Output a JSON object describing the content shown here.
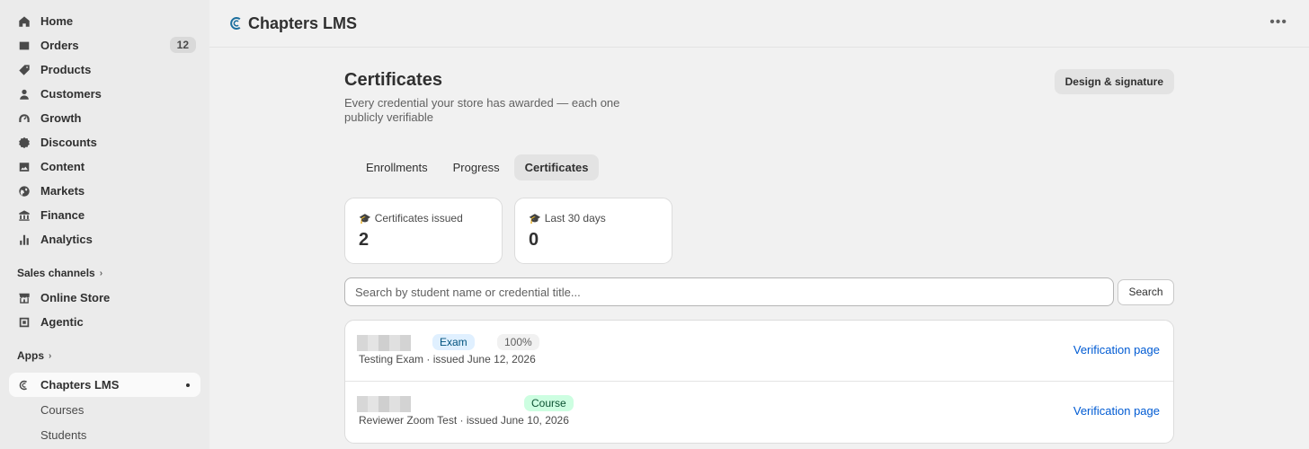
{
  "sidebar": {
    "items": [
      {
        "label": "Home",
        "icon": "home-icon"
      },
      {
        "label": "Orders",
        "icon": "orders-icon",
        "badge": "12"
      },
      {
        "label": "Products",
        "icon": "tag-icon"
      },
      {
        "label": "Customers",
        "icon": "person-icon"
      },
      {
        "label": "Growth",
        "icon": "gauge-icon"
      },
      {
        "label": "Discounts",
        "icon": "discount-icon"
      },
      {
        "label": "Content",
        "icon": "image-icon"
      },
      {
        "label": "Markets",
        "icon": "globe-icon"
      },
      {
        "label": "Finance",
        "icon": "bank-icon"
      },
      {
        "label": "Analytics",
        "icon": "bar-chart-icon"
      }
    ],
    "sales_channels_label": "Sales channels",
    "channels": [
      {
        "label": "Online Store",
        "icon": "store-icon"
      },
      {
        "label": "Agentic",
        "icon": "agentic-icon"
      }
    ],
    "apps_label": "Apps",
    "active_app": "Chapters LMS",
    "app_subitems": [
      "Courses",
      "Students"
    ]
  },
  "header": {
    "app_title": "Chapters LMS"
  },
  "page": {
    "title": "Certificates",
    "subtitle": "Every credential your store has awarded — each one publicly verifiable",
    "design_button": "Design & signature"
  },
  "tabs": [
    {
      "label": "Enrollments"
    },
    {
      "label": "Progress"
    },
    {
      "label": "Certificates",
      "active": true
    }
  ],
  "stats": [
    {
      "label": "Certificates issued",
      "value": "2"
    },
    {
      "label": "Last 30 days",
      "value": "0"
    }
  ],
  "search": {
    "placeholder": "Search by student name or credential title...",
    "button": "Search"
  },
  "certificates": [
    {
      "type": "Exam",
      "score": "100%",
      "meta": "Testing Exam · issued June 12, 2026",
      "link": "Verification page"
    },
    {
      "type": "Course",
      "meta": "Reviewer Zoom Test · issued June 10, 2026",
      "link": "Verification page"
    }
  ],
  "colors": {
    "link": "#005bd3",
    "exam_tag_bg": "#e0f0ff",
    "course_tag_bg": "#cdfee1"
  }
}
